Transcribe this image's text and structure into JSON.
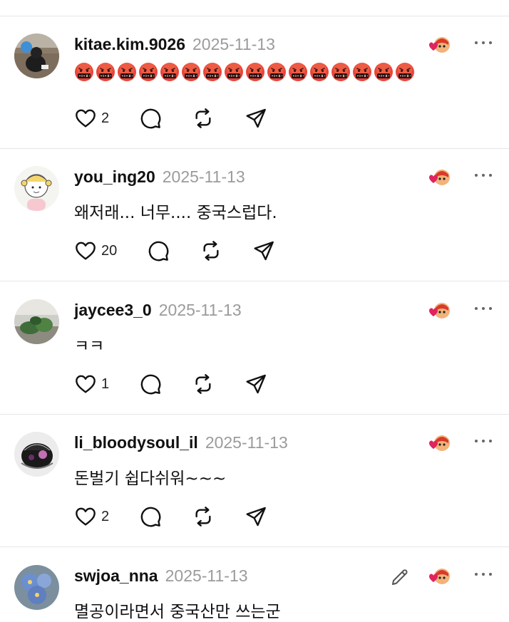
{
  "comments": [
    {
      "username": "kitae.kim.9026",
      "date": "2025-11-13",
      "text": "",
      "emoji_reaction": "face-with-symbols-over-mouth",
      "emoji_count": 16,
      "likes": "2"
    },
    {
      "username": "you_ing20",
      "date": "2025-11-13",
      "text": "왜저래... 너무.... 중국스럽다.",
      "likes": "20"
    },
    {
      "username": "jaycee3_0",
      "date": "2025-11-13",
      "text": "ㅋㅋ",
      "likes": "1"
    },
    {
      "username": "li_bloodysoul_il",
      "date": "2025-11-13",
      "text": "돈벌기 쉽다쉬워~~~",
      "likes": "2"
    },
    {
      "username": "swjoa_nna",
      "date": "2025-11-13",
      "text": "멸공이라면서 중국산만 쓰는군",
      "likes": ""
    }
  ],
  "colors": {
    "heart_red": "#e0245e",
    "date_gray": "#9b9b9b",
    "divider": "#e6e6e6"
  },
  "icons": [
    "heart-icon",
    "comment-icon",
    "repost-icon",
    "share-icon",
    "more-icon",
    "edit-icon",
    "author-liked-badge"
  ]
}
